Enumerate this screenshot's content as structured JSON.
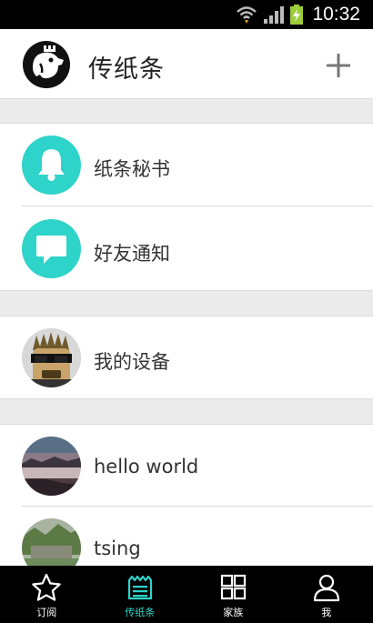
{
  "status_bar": {
    "time": "10:32"
  },
  "header": {
    "title": "传纸条",
    "add_icon": "plus-icon"
  },
  "colors": {
    "accent": "#2ed3c9",
    "gap": "#ebebeb",
    "nav_bg": "#000000"
  },
  "items": [
    {
      "label": "纸条秘书",
      "icon": "bell-icon"
    },
    {
      "label": "好友通知",
      "icon": "chat-bubble-icon"
    },
    {
      "label": "我的设备",
      "icon": "device-avatar"
    },
    {
      "label": "hello world",
      "icon": "contact-avatar"
    },
    {
      "label": "tsing",
      "icon": "contact-avatar"
    }
  ],
  "nav": [
    {
      "label": "订阅",
      "icon": "star-icon",
      "active": false
    },
    {
      "label": "传纸条",
      "icon": "note-icon",
      "active": true
    },
    {
      "label": "家族",
      "icon": "grid-icon",
      "active": false
    },
    {
      "label": "我",
      "icon": "person-icon",
      "active": false
    }
  ]
}
